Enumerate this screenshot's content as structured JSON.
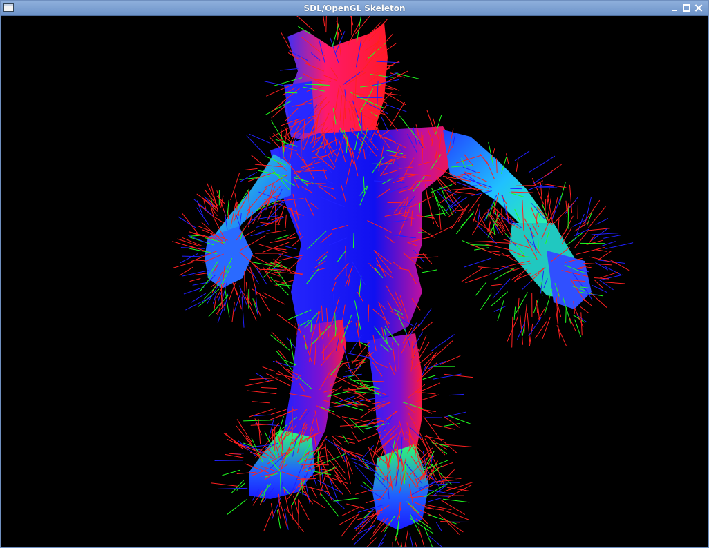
{
  "window": {
    "title": "SDL/OpenGL Skeleton",
    "menu_icon": "window-menu-icon",
    "controls": [
      "minimize-icon",
      "maximize-icon",
      "close-icon"
    ]
  },
  "viewport": {
    "background": "#000000",
    "content": "normal-shaded character model with per-vertex normal/tangent/bitangent lines",
    "colors": {
      "normal_lines": "#ff2020",
      "tangent_lines": "#20ff20",
      "bitangent_lines": "#2020ff",
      "shade_blue": "#1a1aff",
      "shade_red": "#ff1a3a",
      "shade_green": "#20ff80"
    }
  }
}
